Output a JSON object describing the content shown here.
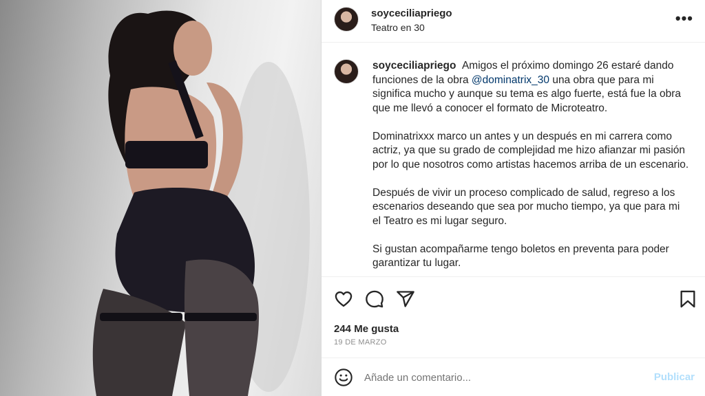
{
  "post": {
    "username": "soyceciliapriego",
    "location": "Teatro en 30",
    "more_label": "•••",
    "caption": {
      "username": "soyceciliapriego",
      "p1_before": "Amigos el próximo domingo 26 estaré dando funciones de la obra",
      "mention": "@dominatrix_30",
      "p1_after": "una obra que para mi significa mucho y aunque su tema es algo fuerte, está fue la obra que me llevó a conocer el formato de Microteatro.",
      "p2": "Dominatrixxx marco un antes y un después en mi carrera como actriz, ya que su grado de complejidad me hizo afianzar mi pasión por lo que nosotros como artistas hacemos arriba de un escenario.",
      "p3": "Después de vivir un proceso complicado de salud, regreso a los escenarios deseando que sea por mucho tiempo, ya que para mi el Teatro es mi lugar seguro.",
      "p4": "Si gustan acompañarme tengo boletos en preventa para poder garantizar tu lugar."
    },
    "likes": "244 Me gusta",
    "date": "19 DE MARZO"
  },
  "comment": {
    "placeholder": "Añade un comentario...",
    "publish_label": "Publicar"
  },
  "colors": {
    "text": "#262626",
    "mention": "#00376b",
    "publish_disabled": "#b2dffc",
    "muted": "#8e8e8e"
  },
  "icons": [
    "heart-icon",
    "comment-icon",
    "share-icon",
    "bookmark-icon",
    "emoji-icon",
    "more-icon"
  ]
}
